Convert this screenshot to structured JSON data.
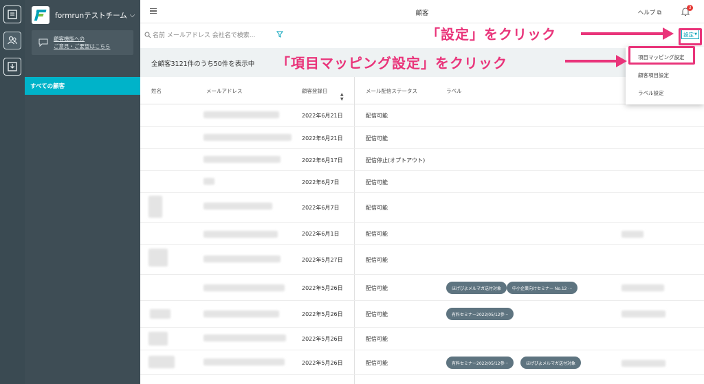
{
  "app": {
    "team_name": "formrunテストチーム"
  },
  "sidebar": {
    "feedback_line1": "顧客機能への",
    "feedback_line2": "ご意見・ご要望はこちら",
    "active_item": "すべての顧客"
  },
  "header": {
    "title": "顧客",
    "help_label": "ヘルプ",
    "notification_count": "3"
  },
  "search": {
    "placeholder": "名前 メールアドレス 会社名で検索..."
  },
  "toolbar": {
    "settings_label": "設定"
  },
  "summary": {
    "text": "全顧客3121件のうち50件を表示中"
  },
  "table": {
    "columns": [
      "姓名",
      "メールアドレス",
      "顧客登録日",
      "メール配信ステータス",
      "ラベル"
    ],
    "rows": [
      {
        "date": "2022年6月21日",
        "status": "配信可能",
        "tags": []
      },
      {
        "date": "2022年6月21日",
        "status": "配信可能",
        "tags": []
      },
      {
        "date": "2022年6月17日",
        "status": "配信停止(オプトアウト)",
        "tags": []
      },
      {
        "date": "2022年6月7日",
        "status": "配信可能",
        "tags": []
      },
      {
        "date": "2022年6月7日",
        "status": "配信可能",
        "tags": []
      },
      {
        "date": "2022年6月1日",
        "status": "配信可能",
        "tags": []
      },
      {
        "date": "2022年5月27日",
        "status": "配信可能",
        "tags": []
      },
      {
        "date": "2022年5月26日",
        "status": "配信可能",
        "tags": [
          "ほげぴよメルマガ送付対象",
          "中小企業向けセミナー No.12 ···"
        ]
      },
      {
        "date": "2022年5月26日",
        "status": "配信可能",
        "tags": [
          "有料セミナー2022/05/12参···"
        ]
      },
      {
        "date": "2022年5月26日",
        "status": "配信可能",
        "tags": []
      },
      {
        "date": "2022年5月26日",
        "status": "配信可能",
        "tags": [
          "有料セミナー2022/05/12参···",
          "ほげぴよメルマガ送付対象"
        ]
      }
    ]
  },
  "dropdown": {
    "items": [
      "項目マッピング設定",
      "顧客項目設定",
      "ラベル設定"
    ]
  },
  "annotations": {
    "click_settings": "「設定」をクリック",
    "click_mapping": "「項目マッピング設定」をクリック"
  },
  "colors": {
    "accent": "#00b3c9",
    "annotation": "#e9347a",
    "sidebar": "#3e4d55",
    "tag": "#5e7480"
  }
}
